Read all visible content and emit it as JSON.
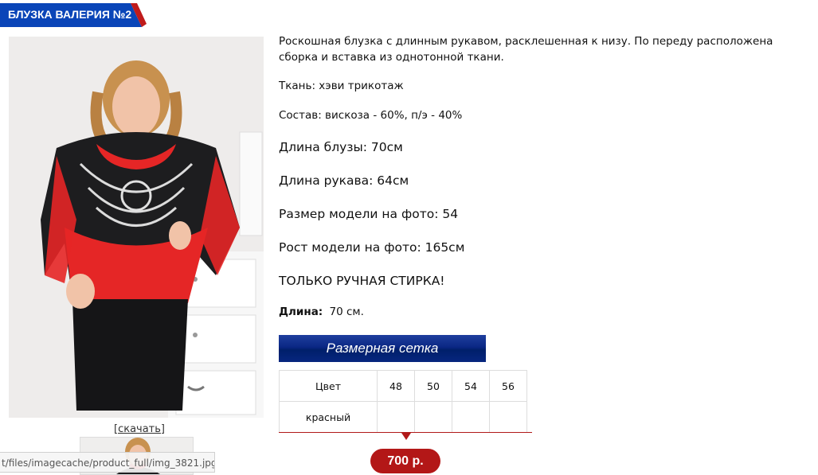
{
  "product": {
    "title": "БЛУЗКА ВАЛЕРИЯ №2",
    "download_link": "[скачать]",
    "status_url": "t/files/imagecache/product_full/img_3821.jpg",
    "description": "Роскошная блузка с длинным рукавом, расклешенная к низу. По переду расположена сборка и вставка из однотонной ткани.",
    "fabric": "Ткань: хэви трикотаж",
    "composition": "Состав: вискоза - 60%, п/э - 40%",
    "blouse_length": "Длина блузы: 70см",
    "sleeve_length": "Длина рукава: 64см",
    "model_size": "Размер модели на фото: 54",
    "model_height": "Рост модели на фото: 165см",
    "care": "ТОЛЬКО РУЧНАЯ СТИРКА!",
    "length_label": "Длина:",
    "length_value": "70 см.",
    "size_chart_button": "Размерная сетка",
    "size_table": {
      "header": [
        "Цвет",
        "48",
        "50",
        "54",
        "56"
      ],
      "rows": [
        [
          "красный",
          "",
          "",
          "",
          ""
        ]
      ]
    },
    "price": "700 р."
  },
  "colors": {
    "title_blue": "#0a45b8",
    "accent_red": "#b31717",
    "button_navy": "#0a2784"
  }
}
